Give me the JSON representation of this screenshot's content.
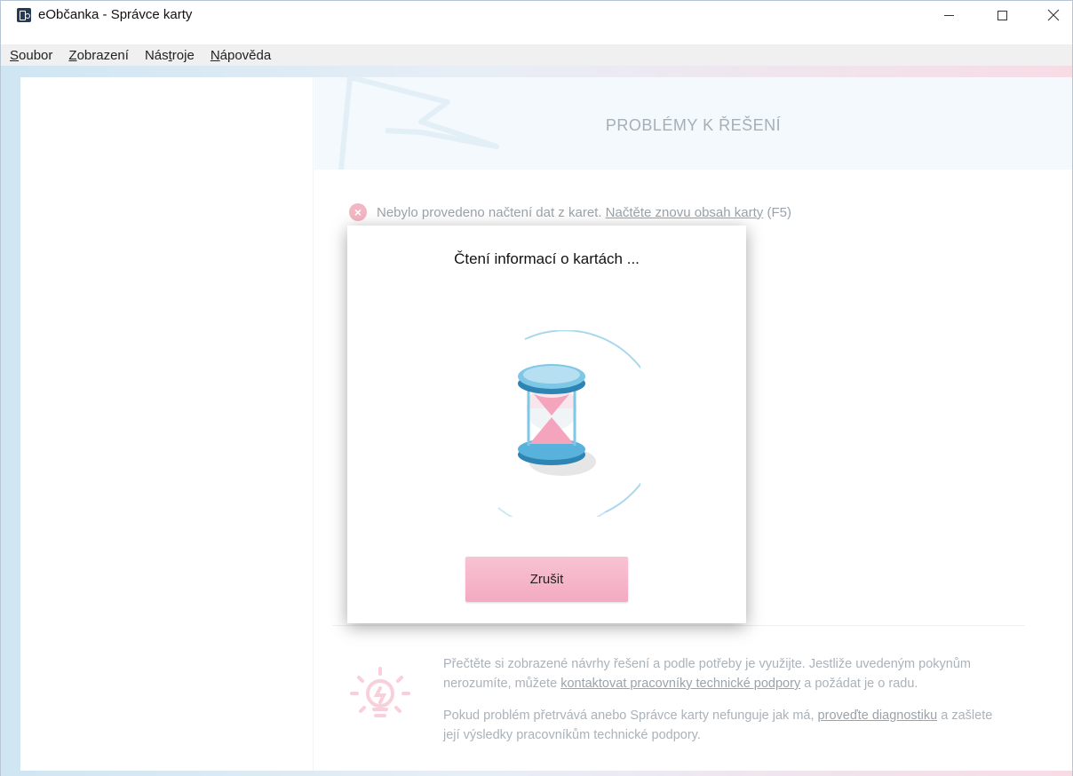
{
  "window": {
    "title": "eObčanka - Správce karty"
  },
  "menu": {
    "items": [
      {
        "pre": "",
        "acc": "S",
        "post": "oubor"
      },
      {
        "pre": "",
        "acc": "Z",
        "post": "obrazení"
      },
      {
        "pre": "Nás",
        "acc": "t",
        "post": "roje"
      },
      {
        "pre": "",
        "acc": "N",
        "post": "ápověda"
      }
    ]
  },
  "main": {
    "title": "PROBLÉMY K ŘEŠENÍ",
    "error": {
      "text": "Nebylo provedeno načtení dat z karet.",
      "link": "Načtěte znovu obsah karty",
      "suffix": "(F5)"
    },
    "tips": {
      "p1_text": "Přečtěte si zobrazené návrhy řešení a podle potřeby je využijte. Jestliže uvedeným pokynům nerozumíte, můžete",
      "p1_link": "kontaktovat pracovníky technické podpory",
      "p1_suffix": "a požádat je o radu.",
      "p2_text": "Pokud problém přetrvává anebo Správce karty nefunguje jak má,",
      "p2_link": "proveďte diagnostiku",
      "p2_suffix": "a zašlete její výsledky pracovníkům technické podpory."
    }
  },
  "modal": {
    "title": "Čtení informací o kartách ...",
    "cancel_label": "Zrušit"
  },
  "colors": {
    "accent_pink": "#f4aac1",
    "accent_blue": "#8ecae6",
    "error_icon": "#f3b6c4"
  }
}
